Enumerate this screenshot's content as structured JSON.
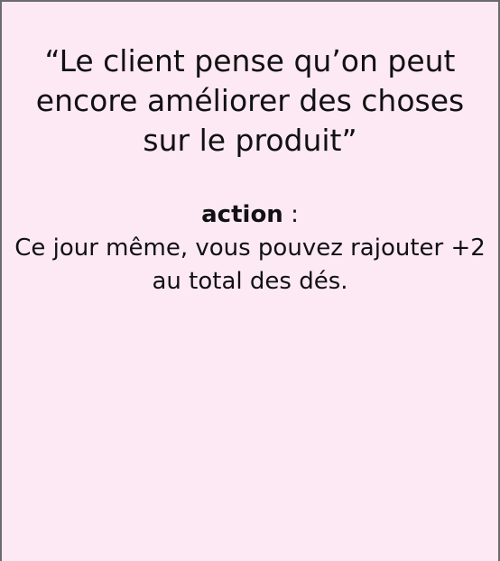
{
  "card": {
    "quote": "“Le client pense qu’on peut encore améliorer des choses sur le produit”",
    "action_label": "action",
    "action_separator": " :",
    "action_text": "Ce jour même, vous pouvez rajouter +2 au total des dés."
  },
  "colors": {
    "background": "#fde9f4",
    "border": "#6b6b6b",
    "text": "#111111"
  }
}
